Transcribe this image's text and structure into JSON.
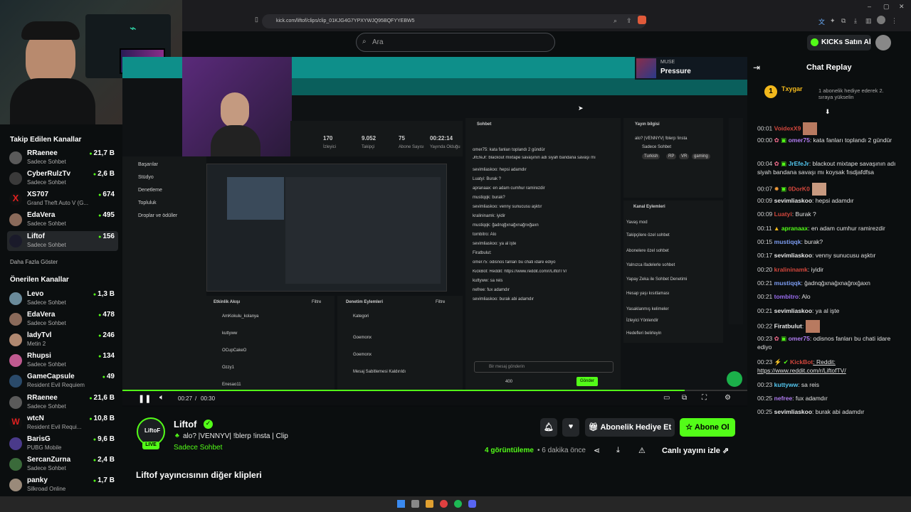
{
  "browser": {
    "url": "kick.com/liftof/clips/clip_01KJG4G7YPXYWJQ95BQFYYEBW5",
    "window_controls": [
      "–",
      "▢",
      "✕"
    ]
  },
  "header": {
    "search_placeholder": "Ara",
    "buy_kicks": "KICKs Satın Al"
  },
  "sidebar": {
    "followed_title": "Takip Edilen Kanallar",
    "followed": [
      {
        "name": "RRaenee",
        "category": "Sadece Sohbet",
        "viewers": "21,7 B"
      },
      {
        "name": "CyberRulzTv",
        "category": "Sadece Sohbet",
        "viewers": "2,6 B"
      },
      {
        "name": "XS707",
        "category": "Grand Theft Auto V (G...",
        "viewers": "674"
      },
      {
        "name": "EdaVera",
        "category": "Sadece Sohbet",
        "viewers": "495"
      },
      {
        "name": "Liftof",
        "category": "Sadece Sohbet",
        "viewers": "156"
      }
    ],
    "show_more": "Daha Fazla Göster",
    "recommended_title": "Önerilen Kanallar",
    "recommended": [
      {
        "name": "Levo",
        "category": "Sadece Sohbet",
        "viewers": "1,3 B"
      },
      {
        "name": "EdaVera",
        "category": "Sadece Sohbet",
        "viewers": "478"
      },
      {
        "name": "ladyTvl",
        "category": "Metin 2",
        "viewers": "246"
      },
      {
        "name": "Rhupsi",
        "category": "Sadece Sohbet",
        "viewers": "134"
      },
      {
        "name": "GameCapsule",
        "category": "Resident Evil Requiem",
        "viewers": "49"
      },
      {
        "name": "RRaenee",
        "category": "Sadece Sohbet",
        "viewers": "21,6 B"
      },
      {
        "name": "wtcN",
        "category": "Resident Evil Requi...",
        "viewers": "10,8 B"
      },
      {
        "name": "BarisG",
        "category": "PUBG Mobile",
        "viewers": "9,6 B"
      },
      {
        "name": "SercanZurna",
        "category": "Sadece Sohbet",
        "viewers": "2,4 B"
      },
      {
        "name": "panky",
        "category": "Silkroad Online",
        "viewers": "1,7 B"
      }
    ]
  },
  "video": {
    "time_current": "00:27",
    "time_total": "00:30",
    "separator": "/",
    "progress": 0.9,
    "nested": {
      "music_label": "MUSE",
      "music_title": "Pressure",
      "stats": [
        {
          "value": "170",
          "label": "İzleyici"
        },
        {
          "value": "9.052",
          "label": "Takipçi"
        },
        {
          "value": "75",
          "label": "Abone Sayısı"
        },
        {
          "value": "00:22:14",
          "label": "Yayında Olduğu"
        }
      ],
      "menu": [
        "Başarılar",
        "Stüdyo",
        "Denetleme",
        "Topluluk",
        "Droplar ve ödüller"
      ],
      "chat_title": "Sohbet",
      "info_title": "Yayın bilgisi",
      "info_line": "alo? |VENNYV| !blerp !insta",
      "info_cat": "Sadece Sohbet",
      "tags": [
        "Turkish",
        "RP",
        "VR",
        "gaming"
      ],
      "actions_title": "Kanal Eylemleri",
      "actions": [
        "Yavaş mod",
        "Takipçilere özel sohbet",
        "Abonelere özel sohbet",
        "Yalnızca ifadelerle sohbet",
        "Yapay Zeka ile Sohbet Denetimi",
        "Hesap yaşı kısıtlaması",
        "Yasaklanmış kelimeler",
        "İzleyici Yönlendir",
        "Hedefleri belirleyin"
      ],
      "activity_title": "Etkinlik Akışı",
      "activity": [
        "AmKokulu_kolanya",
        "kuttyww",
        "OCupCakeO",
        "Ozzy1",
        "Enesao11"
      ],
      "mod_title": "Denetim Eylemleri",
      "mod": [
        "Kategori",
        "Goemonx",
        "Goemonx",
        "Mesaj Sabitlemesi Kaldırıldı"
      ],
      "filter": "Filtre",
      "send_placeholder": "Bir mesaj gönderin",
      "send": "Gönder",
      "points": "400",
      "chat_lines": [
        "omer75: kata fanları toplandı 2 gündür",
        "JrEfeJr: blackout mixtape savaşının adı siyah bandana savaşı mı",
        "sevimliaskoo: hepsi adamdır",
        "Luatyi: Burak ?",
        "apranaax: en adam cumhur ramirezdir",
        "mustiqqk: burak?",
        "sevimliaskoo: venny sunucusu aşktır",
        "kralininamk: iyidir",
        "mustiqqk: ğadnqğxnağxnağnxğaxn",
        "tombitro: Alo",
        "sevimliaskoo: ya al işte",
        "Firatbulut:",
        "omer75: odisnos fanları bu chati idare ediyo",
        "KickBot: Reddit: https://www.reddit.com/r/LiftofTV/",
        "kuttyww: sa reis",
        "nefree: fux adamdır",
        "sevimliaskoo: burak abi adamdır"
      ]
    }
  },
  "clip": {
    "streamer": "Liftof",
    "live_badge": "LIVE",
    "title": "alo? |VENNYV| !blerp !insta | Clip",
    "category": "Sadece Sohbet",
    "views": "4 görüntüleme",
    "age": "• 6 dakika önce",
    "gift_sub": "Abonelik Hediye Et",
    "subscribe": "Abone Ol",
    "watch_live": "Canlı yayını izle"
  },
  "more_clips_title": "Liftof yayıncısının diğer klipleri",
  "chat": {
    "title": "Chat Replay",
    "pinned_user": "Txygar",
    "pinned_text": "1 abonelik hediye ederek 2. sıraya yükselin",
    "messages": [
      {
        "time": "00:01",
        "user": "VoidexX9",
        "color": "#d2463c",
        "text": ""
      },
      {
        "time": "00:00",
        "user": "omer75",
        "color": "#b07cf0",
        "text": ": kata fanları toplandı 2 gündür"
      },
      {
        "time": "00:04",
        "user": "JrEfeJr",
        "color": "#53c7f0",
        "text": ": blackout mixtape savaşının adı siyah bandana savaşı mı koysak fısdjafdfsa"
      },
      {
        "time": "00:07",
        "user": "0DorK0",
        "color": "#d2463c",
        "text": ""
      },
      {
        "time": "00:09",
        "user": "sevimliaskoo",
        "color": "#e8e8e8",
        "text": ": hepsi adamdır"
      },
      {
        "time": "00:09",
        "user": "Luatyi",
        "color": "#d2463c",
        "text": ": Burak ?"
      },
      {
        "time": "00:11",
        "user": "apranaax",
        "color": "#53fc18",
        "text": ": en adam cumhur ramirezdir"
      },
      {
        "time": "00:15",
        "user": "mustiqqk",
        "color": "#7c9cf0",
        "text": ": burak?"
      },
      {
        "time": "00:17",
        "user": "sevimliaskoo",
        "color": "#e8e8e8",
        "text": ": venny sunucusu aşktır"
      },
      {
        "time": "00:20",
        "user": "kralininamk",
        "color": "#d2463c",
        "text": ": iyidir"
      },
      {
        "time": "00:21",
        "user": "mustiqqk",
        "color": "#7c9cf0",
        "text": ": ğadnqğxnağxnağnxğaxn"
      },
      {
        "time": "00:21",
        "user": "tombitro",
        "color": "#9a6cf0",
        "text": ": Alo"
      },
      {
        "time": "00:21",
        "user": "sevimliaskoo",
        "color": "#e8e8e8",
        "text": ": ya al işte"
      },
      {
        "time": "00:22",
        "user": "Firatbulut",
        "color": "#e8e8e8",
        "text": ":"
      },
      {
        "time": "00:23",
        "user": "omer75",
        "color": "#b07cf0",
        "text": ": odisnos fanları bu chati idare ediyo"
      },
      {
        "time": "00:23",
        "user": "KickBot",
        "color": "#d2463c",
        "text": ": Reddit: https://www.reddit.com/r/LiftofTV/"
      },
      {
        "time": "00:23",
        "user": "kuttyww",
        "color": "#53c7f0",
        "text": ": sa reis"
      },
      {
        "time": "00:25",
        "user": "nefree",
        "color": "#b07cf0",
        "text": ": fux adamdır"
      },
      {
        "time": "00:25",
        "user": "sevimliaskoo",
        "color": "#e8e8e8",
        "text": ": burak abi adamdır"
      }
    ]
  },
  "colors": {
    "brand_green": "#53fc18",
    "bg": "#0b0e0f"
  }
}
